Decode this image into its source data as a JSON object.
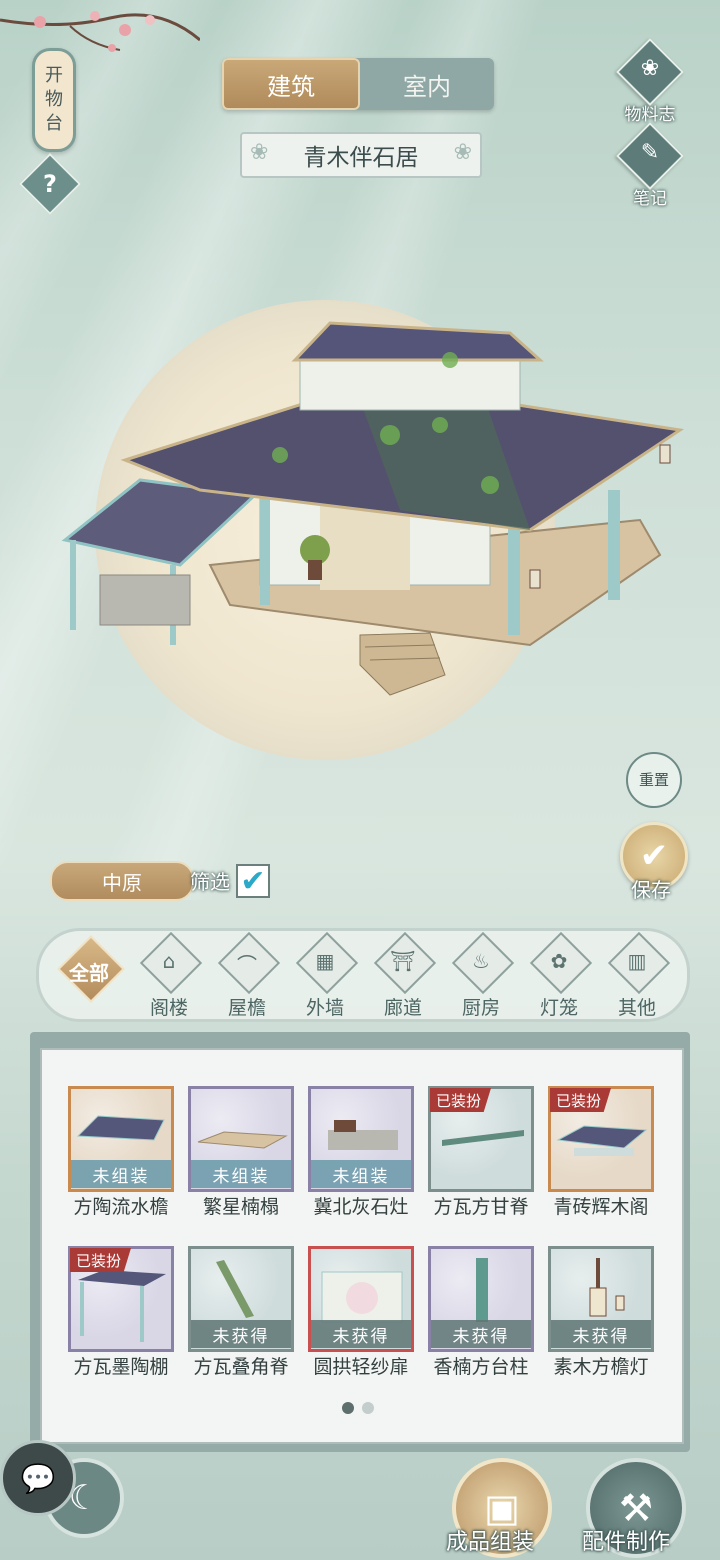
{
  "sign": {
    "chars": [
      "开",
      "物",
      "台"
    ]
  },
  "help": {
    "icon": "?"
  },
  "tabs": [
    {
      "label": "建筑",
      "active": true
    },
    {
      "label": "室内",
      "active": false
    }
  ],
  "building_name": "青木伴石居",
  "right_menu": [
    {
      "label": "物料志",
      "icon": "materials-book-icon",
      "glyph": "❀"
    },
    {
      "label": "笔记",
      "icon": "notebook-icon",
      "glyph": "✎"
    }
  ],
  "reset": {
    "label": "重置"
  },
  "save": {
    "label": "保存",
    "glyph": "✔"
  },
  "region": {
    "label": "中原"
  },
  "filter": {
    "label": "筛选",
    "checked": true,
    "glyph": "✔"
  },
  "categories": [
    {
      "label": "全部",
      "icon": "all-icon",
      "glyph": "",
      "active": true
    },
    {
      "label": "阁楼",
      "icon": "pavilion-icon",
      "glyph": "⌂",
      "active": false
    },
    {
      "label": "屋檐",
      "icon": "eaves-icon",
      "glyph": "⌒",
      "active": false
    },
    {
      "label": "外墙",
      "icon": "wall-icon",
      "glyph": "▦",
      "active": false
    },
    {
      "label": "廊道",
      "icon": "corridor-icon",
      "glyph": "⛩",
      "active": false
    },
    {
      "label": "厨房",
      "icon": "kitchen-icon",
      "glyph": "♨",
      "active": false
    },
    {
      "label": "灯笼",
      "icon": "lantern-icon",
      "glyph": "✿",
      "active": false
    },
    {
      "label": "其他",
      "icon": "other-icon",
      "glyph": "▥",
      "active": false
    }
  ],
  "items": [
    {
      "name": "方陶流水檐",
      "status": "未组装",
      "badge": "",
      "frame": "orange"
    },
    {
      "name": "繁星楠榻",
      "status": "未组装",
      "badge": "",
      "frame": "purple"
    },
    {
      "name": "冀北灰石灶",
      "status": "未组装",
      "badge": "",
      "frame": "purple"
    },
    {
      "name": "方瓦方甘脊",
      "status": "",
      "badge": "已装扮",
      "frame": "blue"
    },
    {
      "name": "青砖辉木阁",
      "status": "",
      "badge": "已装扮",
      "frame": "orange"
    },
    {
      "name": "方瓦墨陶棚",
      "status": "",
      "badge": "已装扮",
      "frame": "purple"
    },
    {
      "name": "方瓦叠角脊",
      "status": "未获得",
      "badge": "",
      "frame": "blue"
    },
    {
      "name": "圆拱轻纱扉",
      "status": "未获得",
      "badge": "",
      "frame": "red"
    },
    {
      "name": "香楠方台柱",
      "status": "未获得",
      "badge": "",
      "frame": "purple"
    },
    {
      "name": "素木方檐灯",
      "status": "未获得",
      "badge": "",
      "frame": "blue"
    }
  ],
  "pagination": {
    "pages": 2,
    "current": 1
  },
  "bottom": {
    "chat_glyph": "💬",
    "back_glyph": "☾",
    "assemble": {
      "label": "成品组装",
      "glyph": "▣"
    },
    "make": {
      "label": "配件制作",
      "glyph": "⚒"
    }
  }
}
